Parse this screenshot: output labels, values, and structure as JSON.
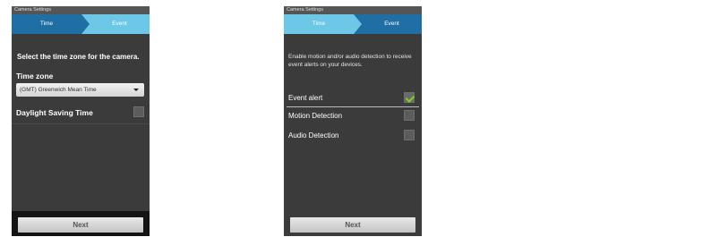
{
  "left_screen": {
    "window_title": "Camera Settings",
    "steps": [
      "Time",
      "Event"
    ],
    "instruction": "Select the time zone for the camera.",
    "timezone_label": "Time zone",
    "timezone_value": "(GMT) Greenwich Mean Time",
    "dst_label": "Daylight Saving Time",
    "dst_checked": false,
    "next_label": "Next"
  },
  "right_screen": {
    "window_title": "Camera Settings",
    "steps": [
      "Time",
      "Event"
    ],
    "instruction": "Enable motion and/or audio detection to receive event alerts on your devices.",
    "options": [
      {
        "label": "Event alert",
        "checked": true
      },
      {
        "label": "Motion Detection",
        "checked": false
      },
      {
        "label": "Audio Detection",
        "checked": false
      }
    ],
    "next_label": "Next"
  },
  "colors": {
    "active_step": "#1f6fa4",
    "inactive_step": "#6cc8e6",
    "checkmark": "#7ed321",
    "screen_background": "#3b3b3b"
  }
}
